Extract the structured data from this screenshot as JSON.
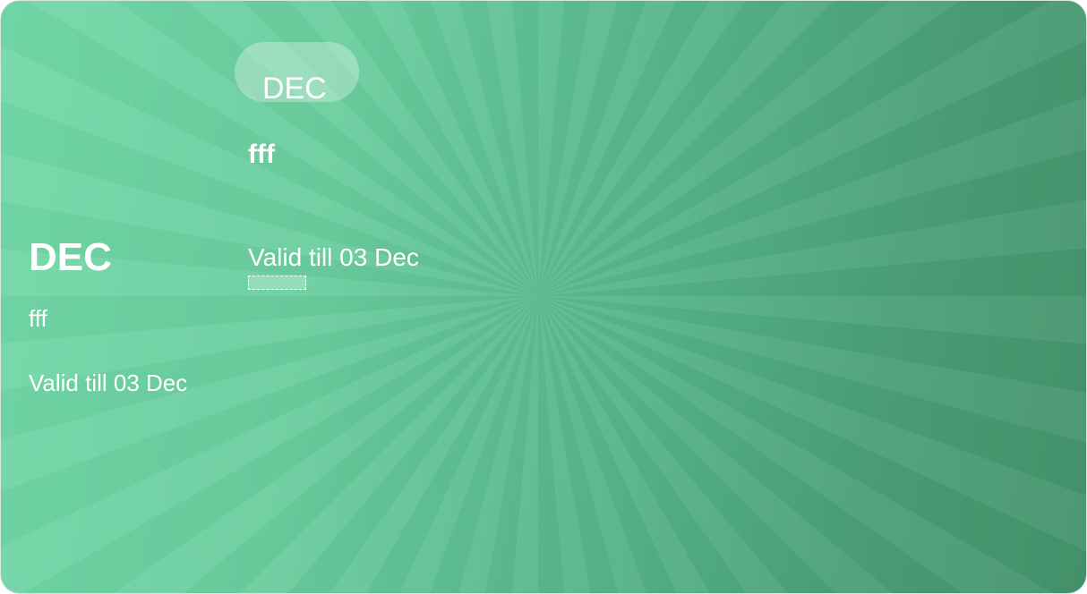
{
  "left": {
    "month": "DEC",
    "name": "fff",
    "validity": "Valid till 03 Dec"
  },
  "right": {
    "month_badge": "DEC",
    "name": "fff",
    "validity": "Valid till 03 Dec"
  },
  "colors": {
    "bg_light": "#72d8a7",
    "bg_dark": "#44936b",
    "text": "#ffffff"
  }
}
